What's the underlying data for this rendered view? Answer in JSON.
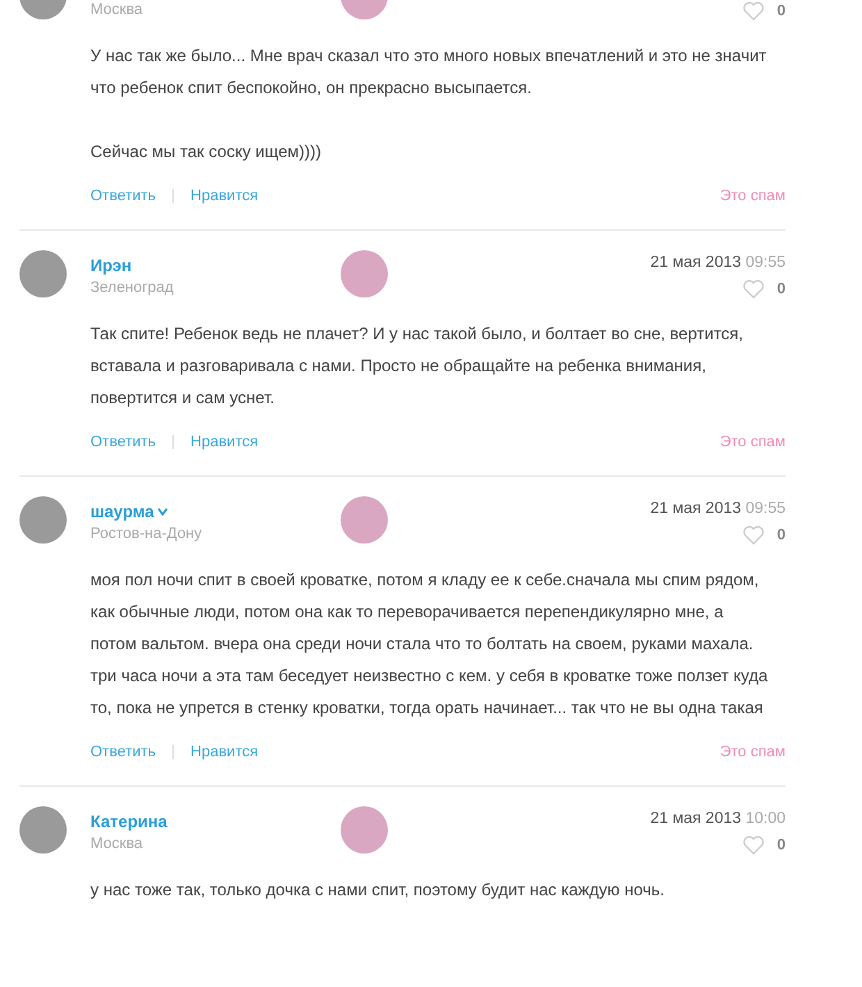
{
  "comments": [
    {
      "location": "Москва",
      "likes": "0",
      "paragraphs": [
        "У нас так же было... Мне врач сказал что это много новых впечатлений и это не значит что ребенок спит беспокойно, он прекрасно высыпается.",
        "Сейчас мы так соску ищем))))"
      ],
      "actions": {
        "reply": "Ответить",
        "like": "Нравится",
        "spam": "Это спам"
      }
    },
    {
      "name": "Ирэн",
      "location": "Зеленоград",
      "date": "21 мая 2013",
      "time": "09:55",
      "likes": "0",
      "paragraphs": [
        "Так спите! Ребенок ведь не плачет? И у нас такой было, и болтает во сне, вертится, вставала и разговаривала с нами. Просто не обращайте на ребенка внимания, повертится и сам уснет."
      ],
      "actions": {
        "reply": "Ответить",
        "like": "Нравится",
        "spam": "Это спам"
      }
    },
    {
      "name": "шаурма",
      "verified": true,
      "location": "Ростов-на-Дону",
      "date": "21 мая 2013",
      "time": "09:55",
      "likes": "0",
      "paragraphs": [
        "моя пол ночи спит в своей кроватке, потом я кладу ее к себе.сначала мы спим рядом, как обычные люди, потом она как то переворачивается перепендикулярно мне, а потом вальтом. вчера она среди ночи стала что то болтать на своем, руками махала. три часа ночи а эта там беседует неизвестно с кем. у себя в кроватке тоже ползет куда то, пока не упрется в стенку кроватки, тогда орать начинает... так что не вы одна такая"
      ],
      "actions": {
        "reply": "Ответить",
        "like": "Нравится",
        "spam": "Это спам"
      }
    },
    {
      "name": "Катерина",
      "location": "Москва",
      "date": "21 мая 2013",
      "time": "10:00",
      "likes": "0",
      "paragraphs": [
        "у нас тоже так, только дочка с нами спит, поэтому будит нас каждую ночь."
      ]
    }
  ]
}
